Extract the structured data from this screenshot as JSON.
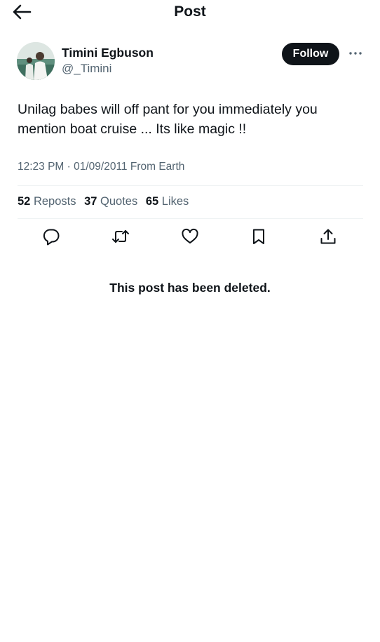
{
  "header": {
    "title": "Post",
    "back_icon": "arrow-left-icon"
  },
  "author": {
    "name": "Timini Egbuson",
    "handle": "@_Timini",
    "follow_label": "Follow",
    "avatar_icon": "avatar-photo",
    "more_icon": "more-horizontal-icon"
  },
  "post": {
    "text_line1": "Unilag babes will off pant for you immediately you",
    "text_line2": "mention boat cruise ... Its like magic !!",
    "meta": "12:23 PM · 01/09/2011 From Earth"
  },
  "stats": {
    "reposts_count": "52",
    "reposts_label": "Reposts",
    "quotes_count": "37",
    "quotes_label": "Quotes",
    "likes_count": "65",
    "likes_label": "Likes"
  },
  "actions": [
    "reply-icon",
    "repost-icon",
    "like-icon",
    "bookmark-icon",
    "share-icon"
  ],
  "deleted_message": "This post has been deleted.",
  "colors": {
    "text": "#0f1419",
    "muted": "#536471",
    "divider": "#eff3f4",
    "button_bg": "#0f1419"
  }
}
